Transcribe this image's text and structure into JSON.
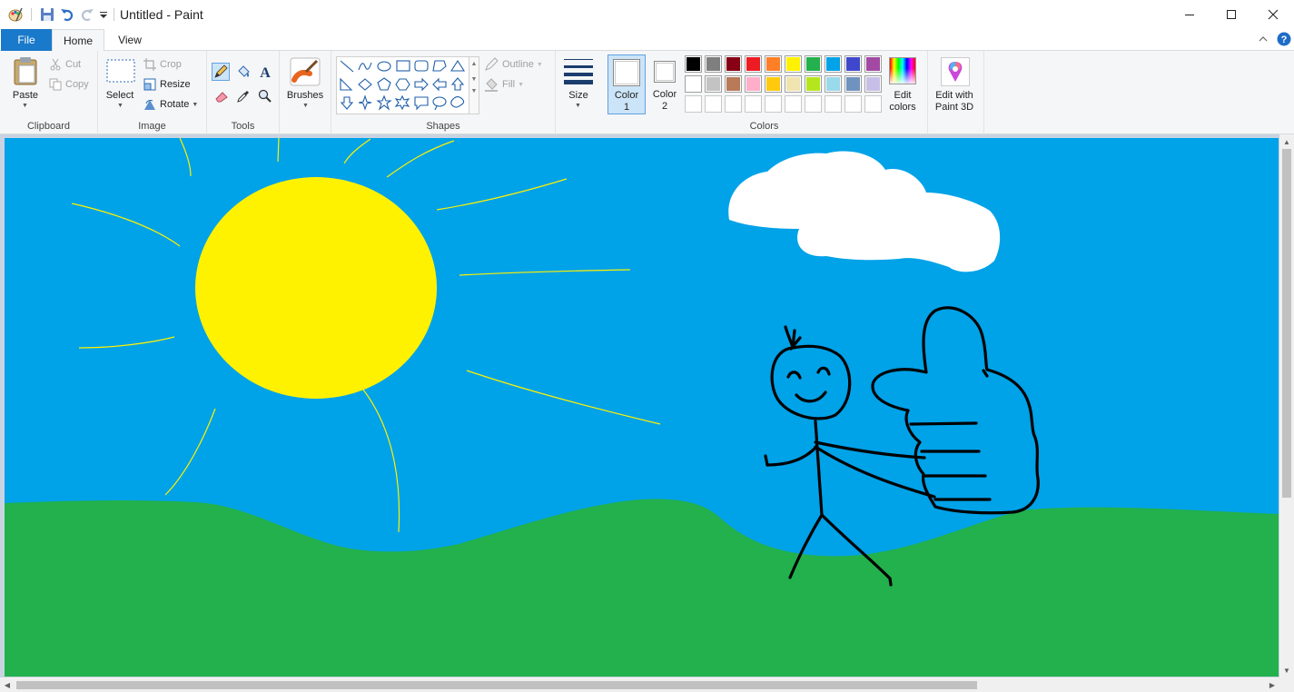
{
  "window": {
    "title": "Untitled - Paint"
  },
  "menu": {
    "file": "File",
    "home": "Home",
    "view": "View"
  },
  "ribbon": {
    "clipboard": {
      "paste": "Paste",
      "cut": "Cut",
      "copy": "Copy",
      "group": "Clipboard"
    },
    "image": {
      "select": "Select",
      "crop": "Crop",
      "resize": "Resize",
      "rotate": "Rotate",
      "group": "Image"
    },
    "tools": {
      "group": "Tools"
    },
    "brushes": {
      "label": "Brushes"
    },
    "shapes": {
      "outline": "Outline",
      "fill": "Fill",
      "group": "Shapes"
    },
    "size": {
      "label": "Size"
    },
    "colors": {
      "color1_label": "Color",
      "color1_num": "1",
      "color2_label": "Color",
      "color2_num": "2",
      "edit_label_1": "Edit",
      "edit_label_2": "colors",
      "group": "Colors",
      "color1_value": "#ffffff",
      "color2_value": "#ffffff",
      "palette_row1": [
        "#000000",
        "#7f7f7f",
        "#880015",
        "#ed1c24",
        "#ff7f27",
        "#fff200",
        "#22b14c",
        "#00a2e8",
        "#3f48cc",
        "#a349a4"
      ],
      "palette_row2": [
        "#ffffff",
        "#c3c3c3",
        "#b97a57",
        "#ffaec9",
        "#ffc90e",
        "#efe4b0",
        "#b5e61d",
        "#99d9ea",
        "#7092be",
        "#c8bfe7"
      ],
      "palette_row3": [
        "",
        "",
        "",
        "",
        "",
        "",
        "",
        "",
        "",
        ""
      ]
    },
    "paint3d": {
      "label_1": "Edit with",
      "label_2": "Paint 3D"
    }
  },
  "drawing": {
    "sky": "#00a2e8",
    "grass": "#22b14c",
    "sun": "#fff200",
    "cloud": "#ffffff",
    "ink": "#000000"
  }
}
